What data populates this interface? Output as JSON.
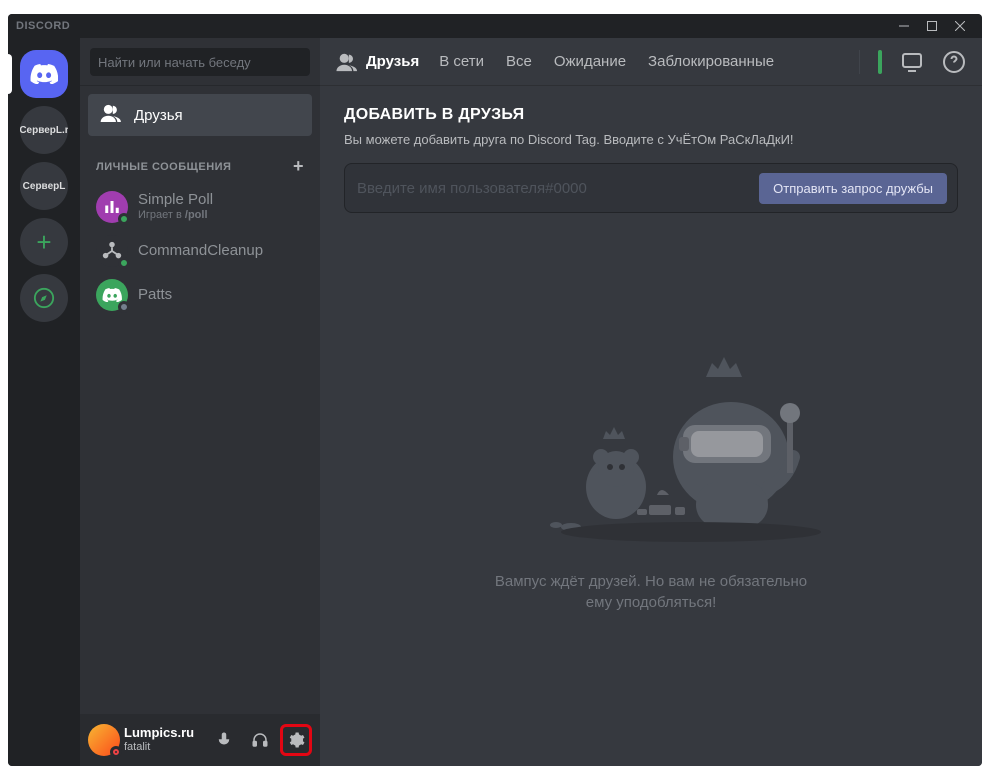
{
  "titlebar": {
    "brand": "DISCORD"
  },
  "guilds": {
    "server1": "СерверL.r",
    "server2": "СерверL"
  },
  "channels": {
    "search_placeholder": "Найти или начать беседу",
    "friends_label": "Друзья",
    "dm_header": "ЛИЧНЫЕ СООБЩЕНИЯ",
    "dms": [
      {
        "name": "Simple Poll",
        "activity_prefix": "Играет в ",
        "activity_game": "/poll",
        "avatar_bg": "#a03daf"
      },
      {
        "name": "CommandCleanup"
      },
      {
        "name": "Patts",
        "avatar_bg": "#3ba55d"
      }
    ]
  },
  "user_panel": {
    "name": "Lumpics.ru",
    "status": "fatalit"
  },
  "header": {
    "title": "Друзья",
    "tabs": {
      "online": "В сети",
      "all": "Все",
      "pending": "Ожидание",
      "blocked": "Заблокированные"
    }
  },
  "add_friend": {
    "title": "ДОБАВИТЬ В ДРУЗЬЯ",
    "subtitle": "Вы можете добавить друга по Discord Tag. Вводите с УчЁтОм РаСкЛаДкИ!",
    "placeholder": "Введите имя пользователя#0000",
    "button": "Отправить запрос дружбы"
  },
  "empty": {
    "text": "Вампус ждёт друзей. Но вам не обязательно ему уподобляться!"
  }
}
